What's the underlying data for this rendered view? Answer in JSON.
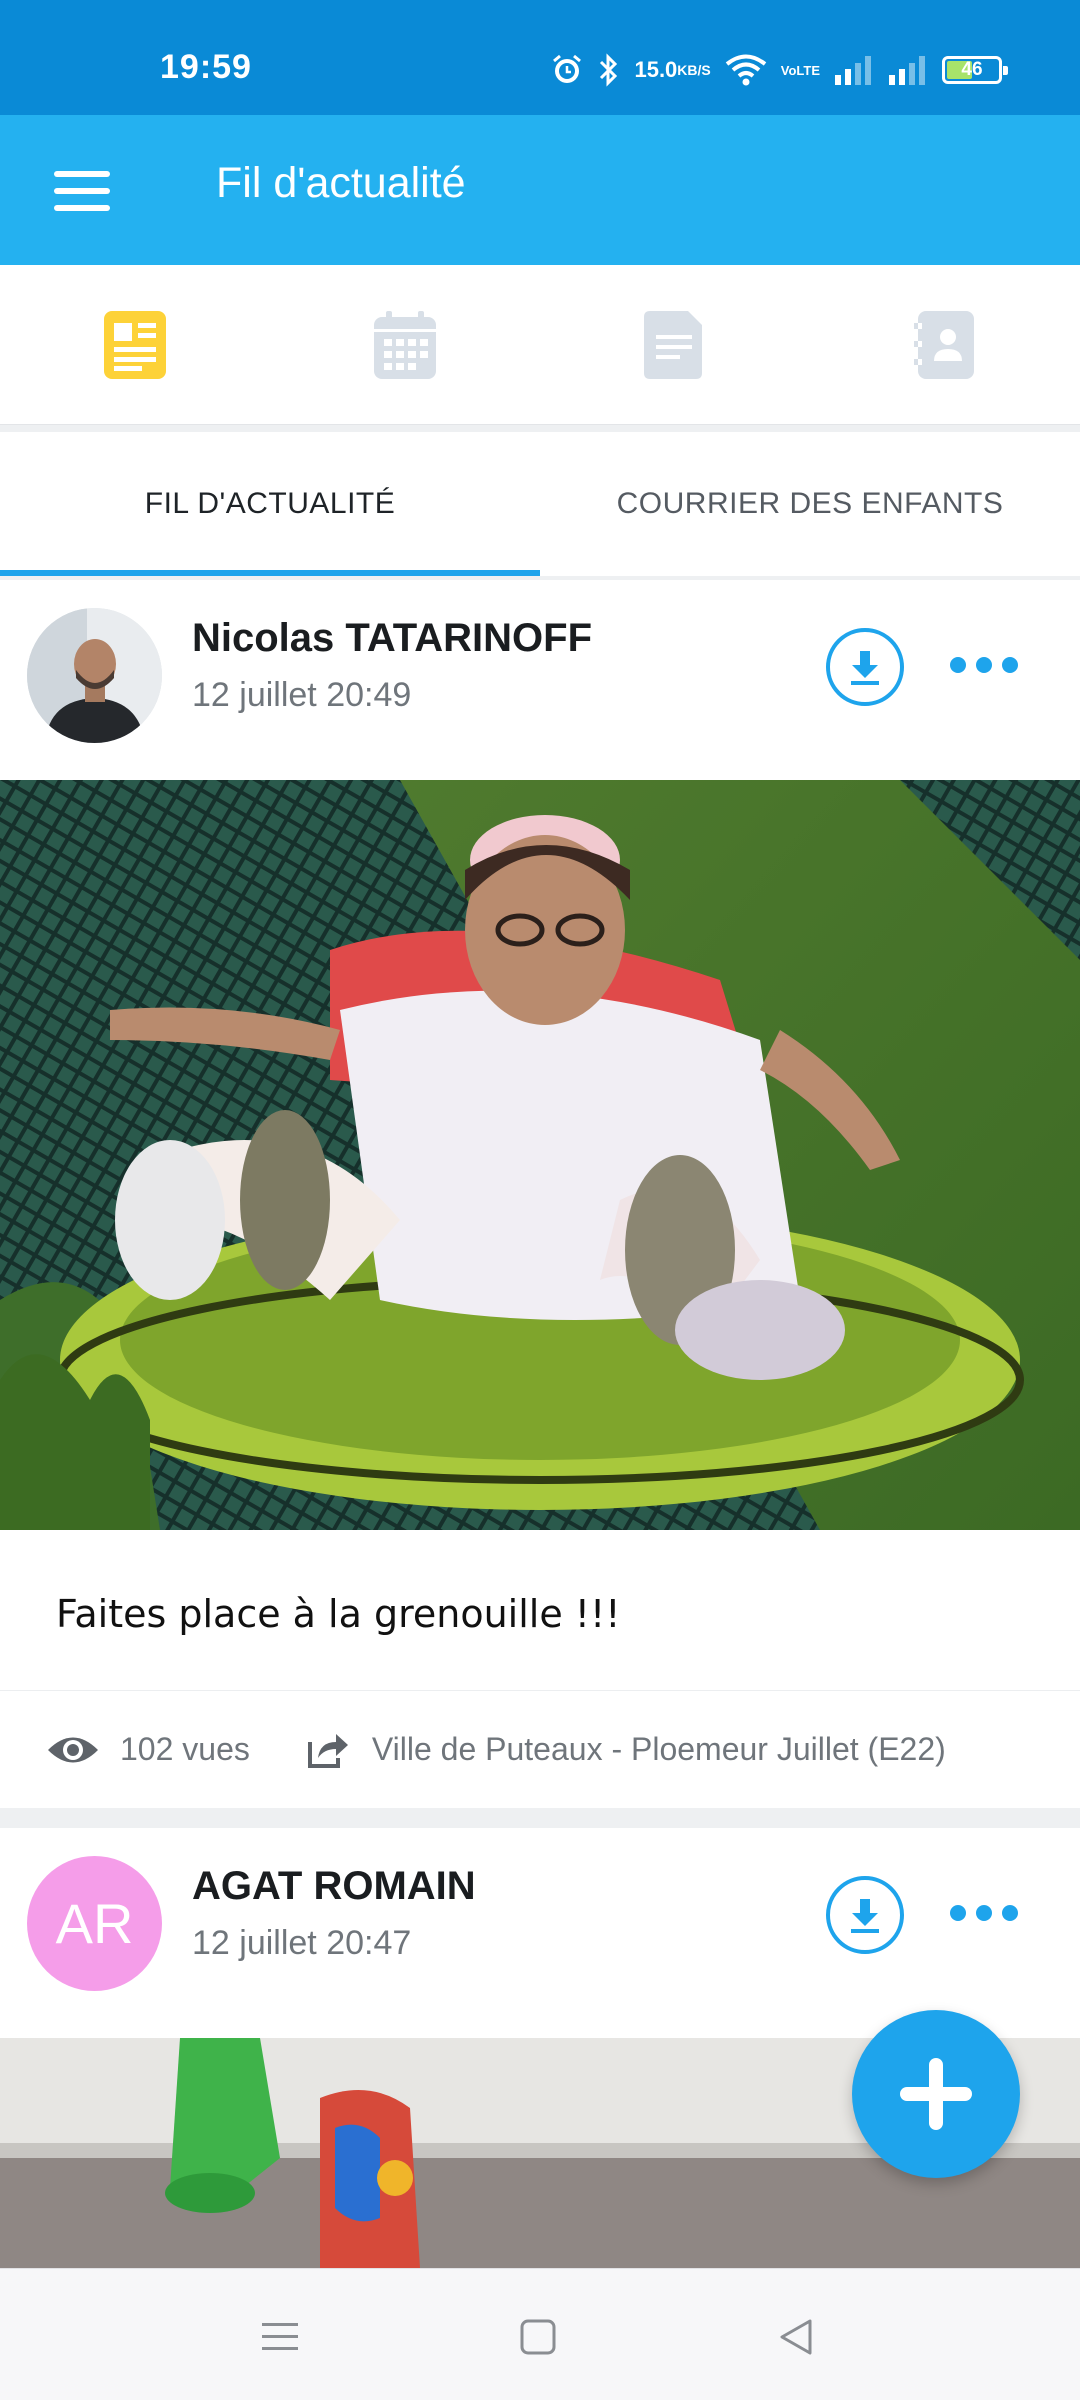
{
  "status_bar": {
    "time": "19:59",
    "net_speed_value": "15.0",
    "net_speed_unit": "KB/S",
    "volte_top": "Vo",
    "volte_bottom": "LTE",
    "battery": "46",
    "icons": [
      "alarm-icon",
      "bluetooth-icon",
      "wifi-icon",
      "signal-icon",
      "signal-icon",
      "battery-icon"
    ]
  },
  "app_bar": {
    "title": "Fil d'actualité",
    "menu_icon": "hamburger-menu-icon"
  },
  "icon_tabs": [
    {
      "name": "news-feed",
      "icon": "newspaper-icon",
      "active": true,
      "color": "#fdd238"
    },
    {
      "name": "calendar",
      "icon": "calendar-icon",
      "active": false,
      "color": "#d8dfe7"
    },
    {
      "name": "documents",
      "icon": "document-icon",
      "active": false,
      "color": "#d8dfe7"
    },
    {
      "name": "contacts",
      "icon": "contact-book-icon",
      "active": false,
      "color": "#d8dfe7"
    }
  ],
  "text_tabs": [
    {
      "label": "FIL D'ACTUALITÉ",
      "active": true
    },
    {
      "label": "COURRIER DES ENFANTS",
      "active": false
    }
  ],
  "posts": [
    {
      "author": "Nicolas TATARINOFF",
      "date": "12 juillet 20:49",
      "caption": "Faites place à la grenouille !!!",
      "views": "102 vues",
      "shared_to": "Ville de Puteaux - Ploemeur Juillet (E22)"
    },
    {
      "author": "AGAT ROMAIN",
      "initials": "AR",
      "date": "12 juillet 20:47"
    }
  ],
  "colors": {
    "status_bar": "#0a8ad6",
    "app_bar": "#24b1f0",
    "accent": "#1ea4ec",
    "active_tab_icon": "#fdd238",
    "avatar_initials_bg": "#f59de9"
  }
}
